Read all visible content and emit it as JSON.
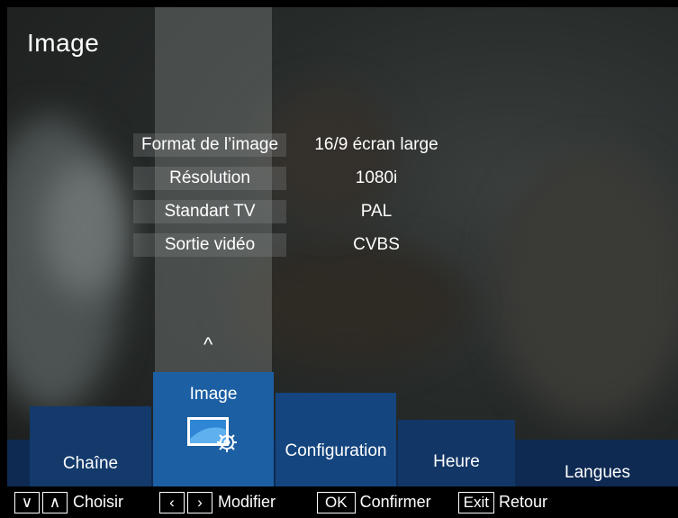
{
  "page": {
    "title": "Image"
  },
  "settings": [
    {
      "label": "Format de l’image",
      "value": "16/9 écran large"
    },
    {
      "label": "Résolution",
      "value": "1080i"
    },
    {
      "label": "Standart TV",
      "value": "PAL"
    },
    {
      "label": "Sortie vidéo",
      "value": "CVBS"
    }
  ],
  "scroll_up_glyph": "^",
  "tabs": {
    "chaine": "Chaîne",
    "image": "Image",
    "configuration": "Configuration",
    "heure": "Heure",
    "langues": "Langues"
  },
  "footer": {
    "choisir_key_down": "∨",
    "choisir_key_up": "∧",
    "choisir": "Choisir",
    "modifier_key_left": "‹",
    "modifier_key_right": "›",
    "modifier": "Modifier",
    "ok_key": "OK",
    "confirmer": "Confirmer",
    "exit_key": "Exit",
    "retour": "Retour"
  },
  "colors": {
    "active_tab": "#1c5fa3",
    "tab_bar": "#0e2a52"
  },
  "icons": {
    "image_tab_icon": "monitor-settings-icon"
  }
}
